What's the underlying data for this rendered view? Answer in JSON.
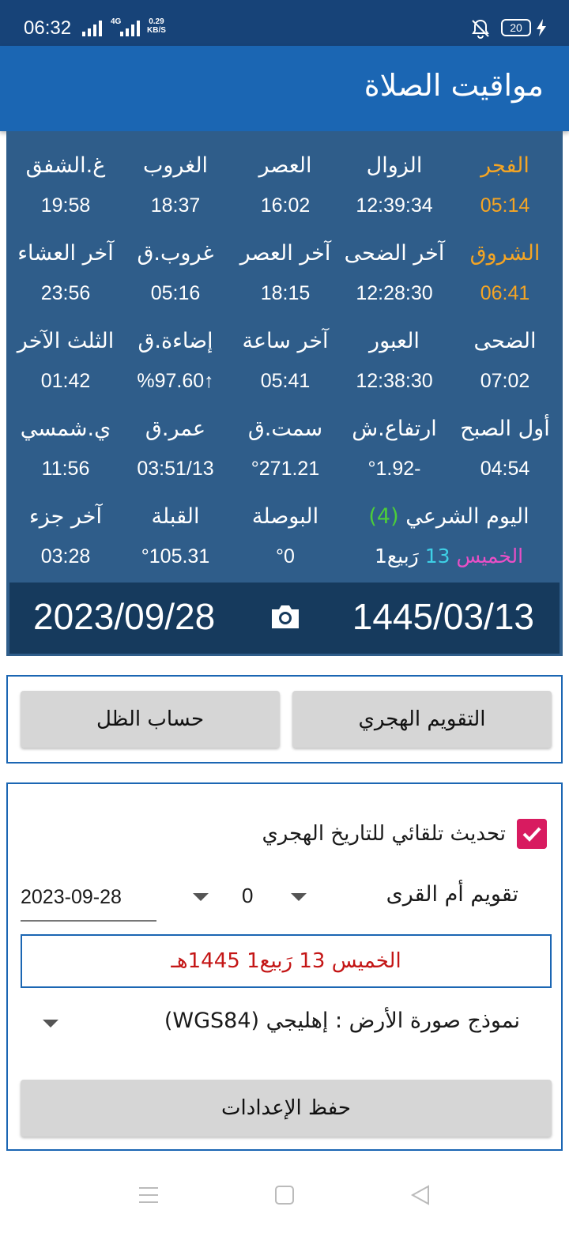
{
  "status_bar": {
    "time": "06:32",
    "network": "4G",
    "speed_value": "0.29",
    "speed_unit": "KB/S",
    "battery": "20"
  },
  "app_bar": {
    "title": "مواقيت الصلاة"
  },
  "prayer_grid": {
    "rows": [
      [
        {
          "label": "الفجر",
          "value": "05:14"
        },
        {
          "label": "الزوال",
          "value": "12:39:34"
        },
        {
          "label": "العصر",
          "value": "16:02"
        },
        {
          "label": "الغروب",
          "value": "18:37"
        },
        {
          "label": "غ.الشفق",
          "value": "19:58"
        }
      ],
      [
        {
          "label": "الشروق",
          "value": "06:41"
        },
        {
          "label": "آخر الضحى",
          "value": "12:28:30"
        },
        {
          "label": "آخر العصر",
          "value": "18:15"
        },
        {
          "label": "غروب.ق",
          "value": "05:16"
        },
        {
          "label": "آخر العشاء",
          "value": "23:56"
        }
      ],
      [
        {
          "label": "الضحى",
          "value": "07:02"
        },
        {
          "label": "العبور",
          "value": "12:38:30"
        },
        {
          "label": "آخر ساعة",
          "value": "05:41"
        },
        {
          "label": "إضاءة.ق",
          "value": "%97.60↑"
        },
        {
          "label": "الثلث الآخر",
          "value": "01:42"
        }
      ],
      [
        {
          "label": "أول الصبح",
          "value": "04:54"
        },
        {
          "label": "ارتفاع.ش",
          "value": "°1.92-"
        },
        {
          "label": "سمت.ق",
          "value": "°271.21"
        },
        {
          "label": "عمر.ق",
          "value": "03:51/13"
        },
        {
          "label": "ي.شمسي",
          "value": "11:56"
        }
      ],
      [
        {
          "label": "اليوم الشرعي",
          "label_extra": "(4)",
          "value_day": "الخميس",
          "value_num": "13",
          "value_month": "رَبيع1"
        },
        {
          "label": "البوصلة",
          "value": "°0"
        },
        {
          "label": "القبلة",
          "value": "°105.31"
        },
        {
          "label": "آخر جزء",
          "value": "03:28"
        }
      ]
    ],
    "colors": {
      "highlight": "#f5a524",
      "panel": "#2f5d8a",
      "date_bar": "#163a5d"
    }
  },
  "date_bar": {
    "gregorian": "2023/09/28",
    "hijri": "1445/03/13"
  },
  "buttons": {
    "hijri_calendar": "التقويم الهجري",
    "shadow_calc": "حساب الظل"
  },
  "settings": {
    "auto_update_label": "تحديث تلقائي للتاريخ الهجري",
    "auto_update_checked": true,
    "calendar_type": "تقويم أم القرى",
    "offset": "0",
    "date_input": "2023-09-28",
    "hijri_result": "الخميس 13 رَبيع1 1445هـ",
    "earth_model": "نموذج صورة الأرض : إهليجي (WGS84)",
    "save_label": "حفظ الإعدادات"
  },
  "nav": {
    "icons": [
      "menu-icon",
      "home-icon",
      "back-icon"
    ]
  }
}
